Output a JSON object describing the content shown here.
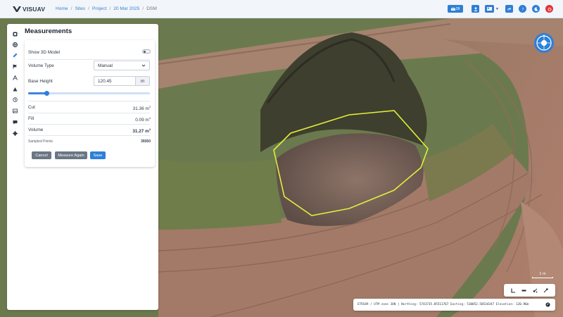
{
  "app": {
    "logo_text": "VISUAV"
  },
  "breadcrumb": {
    "home": "Home",
    "sites": "Sites",
    "project": "Project",
    "date": "20 Mar 2025",
    "current": "DSM",
    "sep": "/"
  },
  "topbar": {
    "notifications_count": "28"
  },
  "panel": {
    "title": "Measurements",
    "show3d_label": "Show 3D Model",
    "volume_type_label": "Volume Type",
    "volume_type_value": "Manual",
    "base_height_label": "Base Height",
    "base_height_value": "120.45",
    "base_height_unit": "m",
    "slider_level": 0.15,
    "cut_label": "Cut",
    "cut_value": "31.36 m",
    "fill_label": "Fill",
    "fill_value": "0.09 m",
    "volume_label": "Volume",
    "volume_value": "31.27 m",
    "cubic_sup": "3",
    "sampled_label": "Sampled Points",
    "sampled_value": "39350",
    "cancel_label": "Cancel",
    "measure_again_label": "Measure Again",
    "save_label": "Save"
  },
  "map": {
    "scale_label": "1 m",
    "coords_prefix": "ETRS89 / UTM zone 30N | Northing: ",
    "northing": "5743735.85511767",
    "easting_label": " Easting: ",
    "easting": "518052.58534347",
    "elevation_label": " Elevation: ",
    "elevation": "120.96m",
    "polygon_color": "#e2ee3a"
  },
  "icons": {
    "sidebar": [
      "layers-icon",
      "globe-icon",
      "ruler-icon",
      "flag-icon",
      "route-icon",
      "mountain-icon",
      "history-icon",
      "images-icon",
      "chat-icon",
      "settings-icon"
    ]
  }
}
